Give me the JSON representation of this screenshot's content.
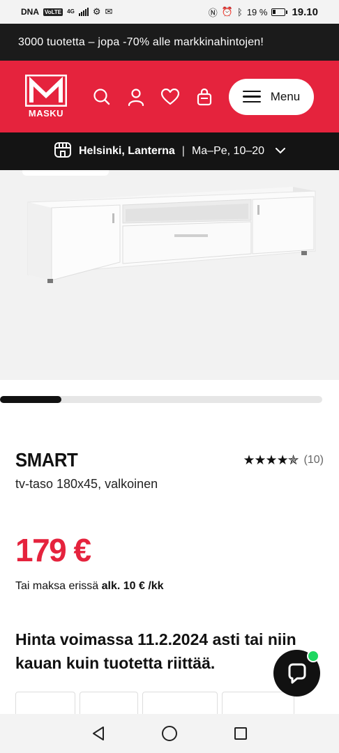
{
  "status_bar": {
    "carrier": "DNA",
    "volte": "VoLTE",
    "network": "4G",
    "battery": "19 %",
    "time": "19.10",
    "icons": [
      "nfc-icon",
      "alarm-icon",
      "bluetooth-icon",
      "battery-icon",
      "signal-icon",
      "settings-icon",
      "message-icon"
    ]
  },
  "promo": {
    "text": "3000 tuotetta – jopa -70% alle markkinahintojen!"
  },
  "header": {
    "brand": "MASKU",
    "menu_label": "Menu",
    "icons": [
      "search-icon",
      "user-icon",
      "heart-icon",
      "bag-icon"
    ],
    "accent_color": "#e5233d"
  },
  "store": {
    "name": "Helsinki, Lanterna",
    "separator": "|",
    "hours": "Ma–Pe, 10–20"
  },
  "carousel": {
    "progress": 0.19
  },
  "product": {
    "name": "SMART",
    "description": "tv-taso 180x45, valkoinen",
    "rating": 4.5,
    "stars": "★★★★✯",
    "review_count": "(10)",
    "price": "179 €",
    "installment_prefix": "Tai maksa erissä",
    "installment_amount": "alk. 10 € /kk",
    "validity": "Hinta voimassa 11.2.2024 asti tai niin kauan kuin tuotetta riittää."
  },
  "navigation": {
    "buttons": [
      "back-icon",
      "home-icon",
      "recents-icon"
    ]
  }
}
